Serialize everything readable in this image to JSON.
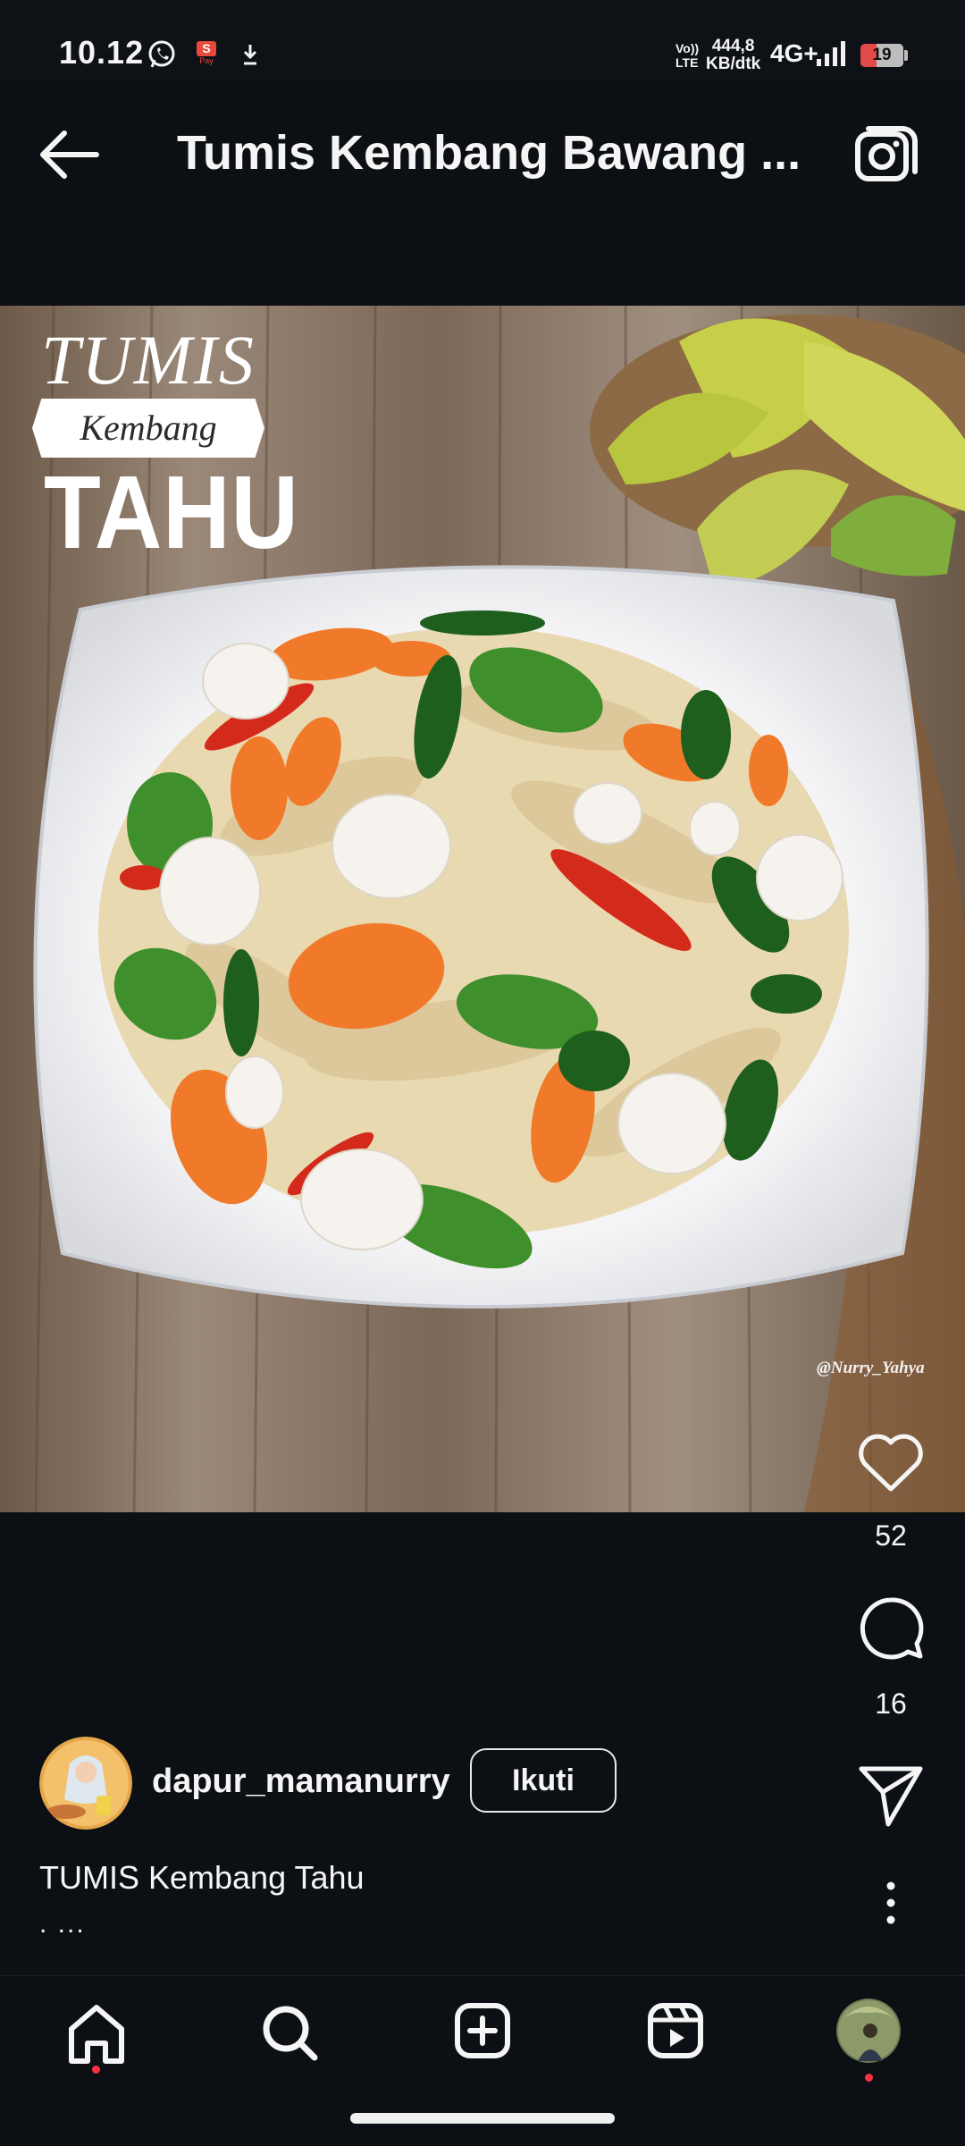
{
  "status_bar": {
    "time": "10.12",
    "volte_line1": "Vo))",
    "volte_line2": "LTE",
    "speed_value": "444,8",
    "speed_unit": "KB/dtk",
    "network": "4G+",
    "battery": "19",
    "notification_icons": [
      "whatsapp-icon",
      "shopeepay-icon",
      "download-icon"
    ],
    "shopeepay_text": "S",
    "shopeepay_sub": "Pay"
  },
  "header": {
    "title": "Tumis Kembang Bawang ...",
    "back_icon": "arrow-left-icon",
    "camera_icon": "camera-icon"
  },
  "post": {
    "overlay_title": {
      "line1": "TUMIS",
      "line2": "Kembang",
      "line3": "TAHU"
    },
    "watermark": "@Nurry_Yahya",
    "likes": "52",
    "comments": "16",
    "author": "dapur_mamanurry",
    "follow_label": "Ikuti",
    "caption": "TUMIS Kembang Tahu",
    "caption_more": ". ..."
  },
  "nav": {
    "items": [
      "home-icon",
      "search-icon",
      "create-icon",
      "reels-icon",
      "profile-avatar"
    ]
  },
  "colors": {
    "background": "#0c1014",
    "text": "#f5f5f5",
    "notification_dot": "#ff3040",
    "battery_low": "#e24a4a"
  }
}
